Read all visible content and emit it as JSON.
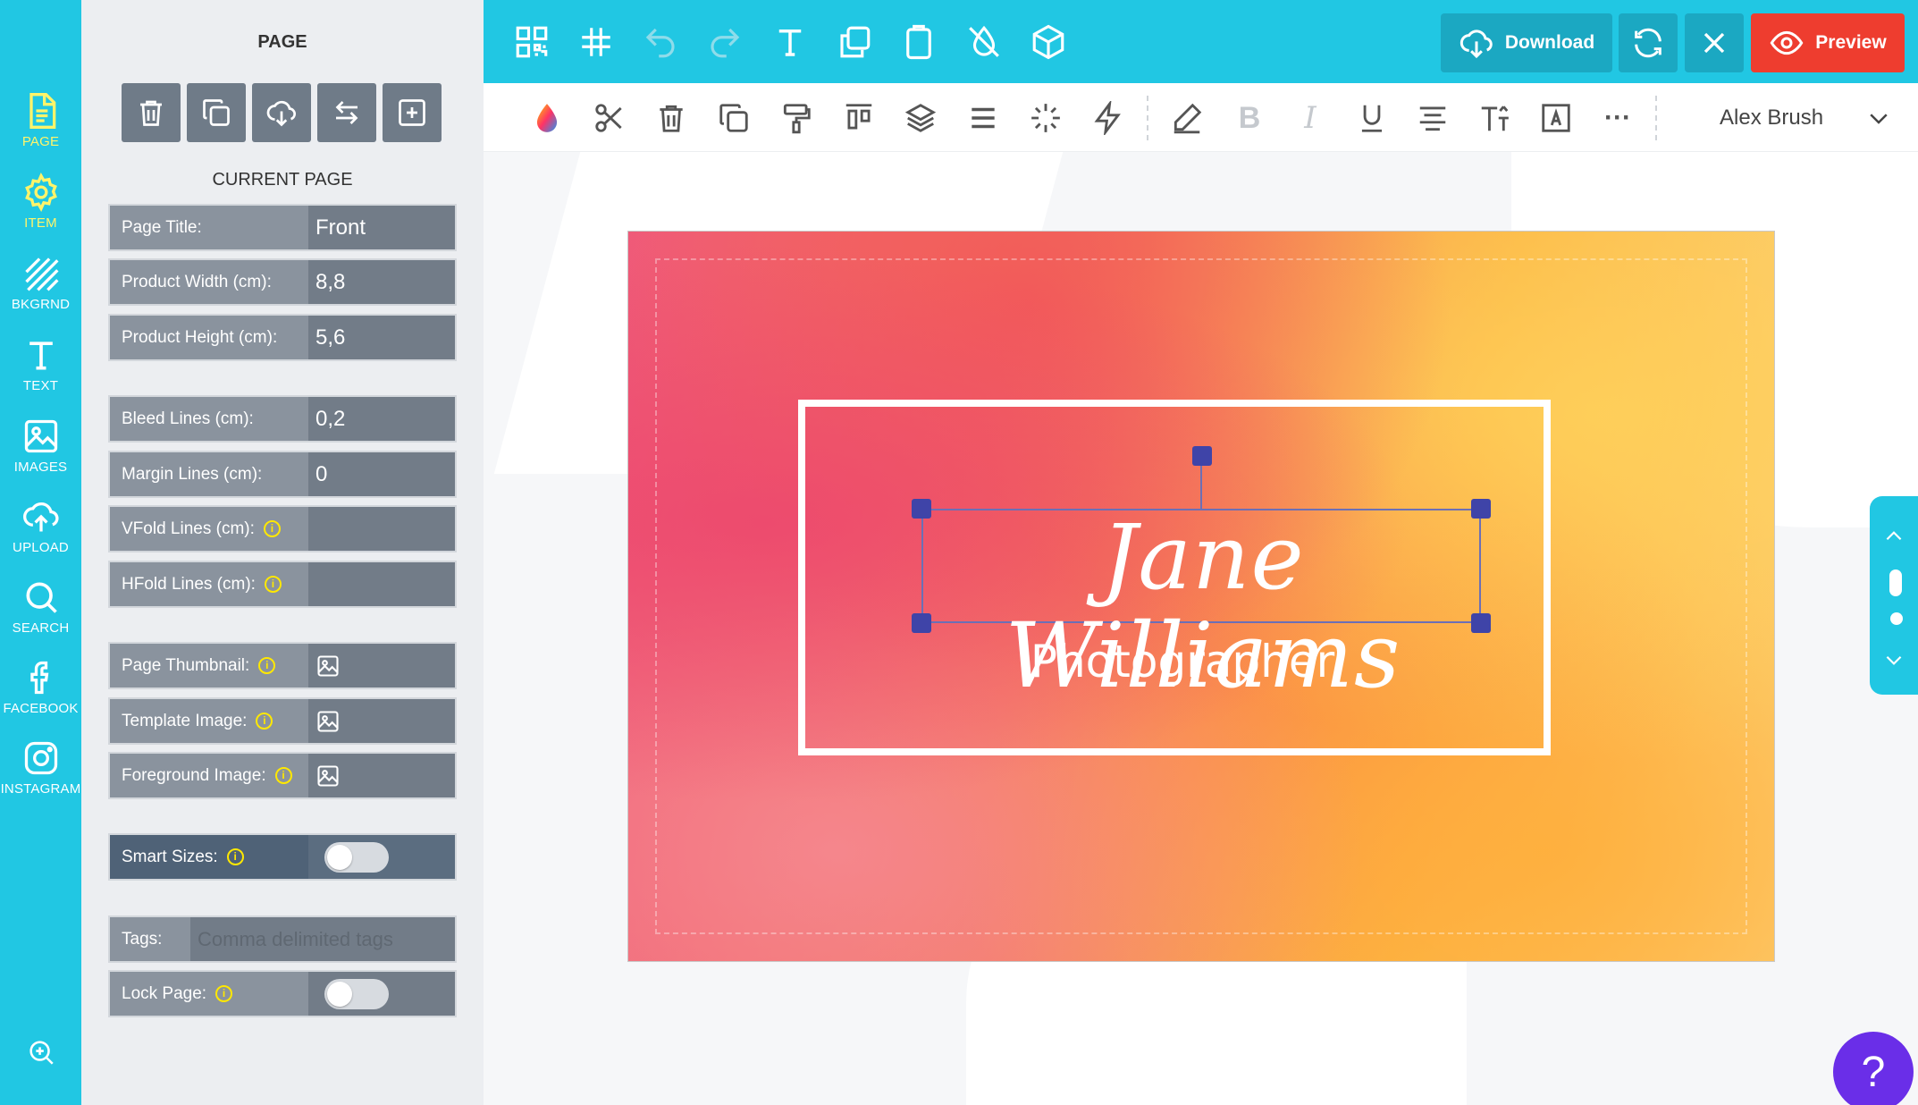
{
  "rail": {
    "items": [
      {
        "label": "PAGE",
        "icon": "page-icon"
      },
      {
        "label": "ITEM",
        "icon": "gear-icon"
      },
      {
        "label": "BKGRND",
        "icon": "stripes-icon"
      },
      {
        "label": "TEXT",
        "icon": "text-icon"
      },
      {
        "label": "IMAGES",
        "icon": "image-icon"
      },
      {
        "label": "UPLOAD",
        "icon": "cloud-upload-icon"
      },
      {
        "label": "SEARCH",
        "icon": "search-icon"
      },
      {
        "label": "FACEBOOK",
        "icon": "facebook-icon"
      },
      {
        "label": "INSTAGRAM",
        "icon": "instagram-icon"
      }
    ],
    "zoom_icon": "zoom-in-icon",
    "accent": "#21c7e3",
    "active_color": "#fff46a"
  },
  "panel": {
    "title": "PAGE",
    "current_page": "CURRENT PAGE",
    "buttons": [
      "trash-icon",
      "copy-icon",
      "cloud-download-icon",
      "swap-icon",
      "add-square-icon"
    ],
    "fields": {
      "page_title": {
        "label": "Page Title:",
        "value": "Front"
      },
      "product_width": {
        "label": "Product Width (cm):",
        "value": "8,8"
      },
      "product_height": {
        "label": "Product Height (cm):",
        "value": "5,6"
      },
      "bleed_lines": {
        "label": "Bleed Lines (cm):",
        "value": "0,2"
      },
      "margin_lines": {
        "label": "Margin Lines (cm):",
        "value": "0"
      },
      "vfold_lines": {
        "label": "VFold Lines (cm):",
        "value": ""
      },
      "hfold_lines": {
        "label": "HFold Lines (cm):",
        "value": ""
      },
      "page_thumbnail": {
        "label": "Page Thumbnail:"
      },
      "template_image": {
        "label": "Template Image:"
      },
      "foreground_image": {
        "label": "Foreground Image:"
      },
      "smart_sizes": {
        "label": "Smart Sizes:",
        "on": false
      },
      "tags": {
        "label": "Tags:",
        "placeholder": "Comma delimited tags",
        "value": ""
      },
      "lock_page": {
        "label": "Lock Page:",
        "on": false
      }
    }
  },
  "topbar": {
    "icons": [
      "qr-code-icon",
      "grid-hash-icon",
      "undo-icon",
      "redo-icon",
      "text-tool-icon",
      "shape-duplicate-icon",
      "clipboard-icon",
      "no-drop-icon",
      "box-3d-icon"
    ],
    "download_label": "Download",
    "preview_label": "Preview",
    "preview_color": "#ee3d2f"
  },
  "fmtbar": {
    "icons": [
      "color-drop-icon",
      "scissors-icon",
      "trash-icon",
      "copy-icon",
      "paint-roller-icon",
      "align-top-icon",
      "layers-icon",
      "line-spacing-icon",
      "sparkle-icon",
      "lightning-icon",
      "pen-icon",
      "bold-icon",
      "italic-icon",
      "underline-icon",
      "align-center-icon",
      "text-size-icon",
      "text-box-icon",
      "more-icon"
    ],
    "font": "Alex Brush"
  },
  "canvas": {
    "name": "Jane Williams",
    "subtitle": "Photographer"
  },
  "help_label": "?"
}
